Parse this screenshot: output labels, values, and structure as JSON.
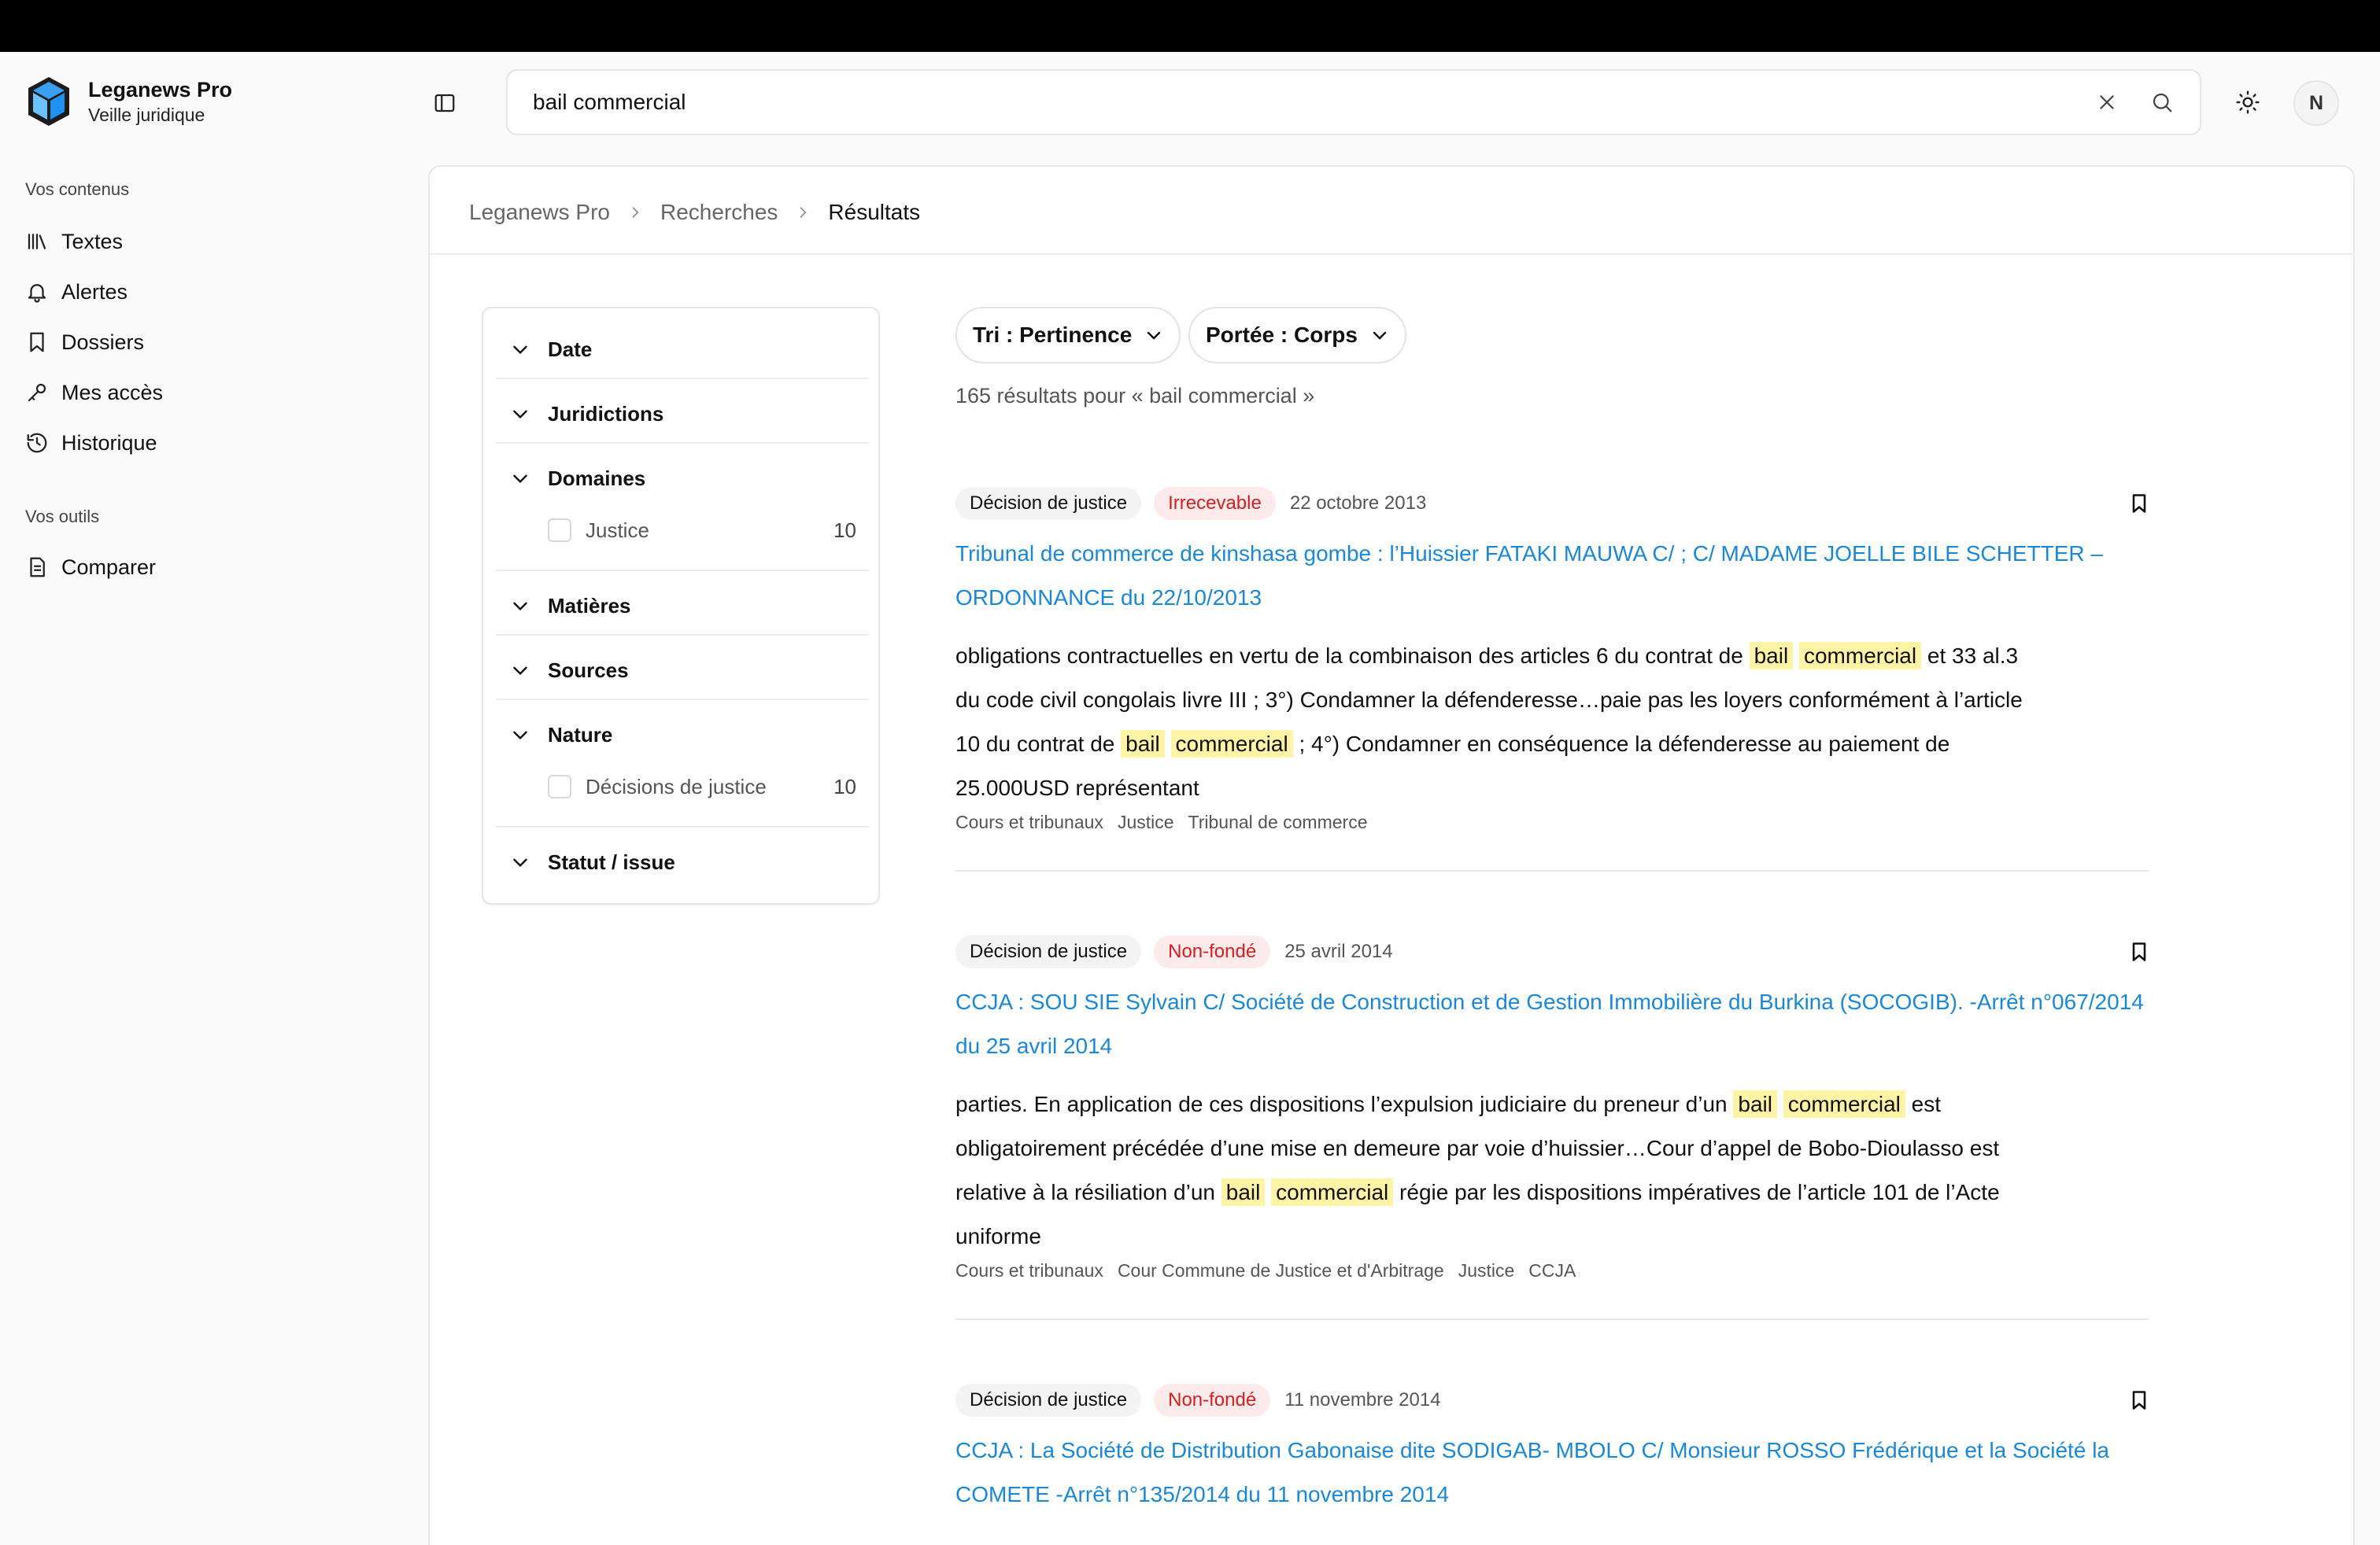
{
  "brand": {
    "name": "Leganews Pro",
    "subtitle": "Veille juridique"
  },
  "sidebar": {
    "section_contents": "Vos contenus",
    "items": [
      {
        "label": "Textes",
        "icon": "library-icon"
      },
      {
        "label": "Alertes",
        "icon": "bell-icon"
      },
      {
        "label": "Dossiers",
        "icon": "bookmark-icon"
      },
      {
        "label": "Mes accès",
        "icon": "key-icon"
      },
      {
        "label": "Historique",
        "icon": "history-icon"
      }
    ],
    "section_tools": "Vos outils",
    "tools": [
      {
        "label": "Comparer",
        "icon": "document-icon"
      }
    ]
  },
  "search": {
    "value": "bail commercial"
  },
  "user": {
    "initial": "N"
  },
  "breadcrumb": [
    "Leganews Pro",
    "Recherches",
    "Résultats"
  ],
  "filters": {
    "date": "Date",
    "juridictions": "Juridictions",
    "domaines": "Domaines",
    "domaines_options": [
      {
        "label": "Justice",
        "count": "10"
      }
    ],
    "matieres": "Matières",
    "sources": "Sources",
    "nature": "Nature",
    "nature_options": [
      {
        "label": "Décisions de justice",
        "count": "10"
      }
    ],
    "statut": "Statut / issue"
  },
  "sort": {
    "tri": "Tri : Pertinence",
    "portee": "Portée : Corps"
  },
  "results_count": "165 résultats pour « bail commercial »",
  "results": [
    {
      "type": "Décision de justice",
      "status": "Irrecevable",
      "date": "22 octobre 2013",
      "title": "Tribunal de commerce de kinshasa gombe : l’Huissier FATAKI MAUWA C/ ; C/ MADAME JOELLE BILE SCHETTER –ORDONNANCE du 22/10/2013",
      "snippet": [
        {
          "t": "obligations contractuelles en vertu de la combinaison des articles 6 du contrat de "
        },
        {
          "t": "bail",
          "h": true
        },
        {
          "t": " "
        },
        {
          "t": "commercial",
          "h": true
        },
        {
          "t": " et 33 al.3 du code civil congolais livre III ; 3°) Condamner la défenderesse…paie pas les loyers conformément à l’article 10 du contrat de "
        },
        {
          "t": "bail",
          "h": true
        },
        {
          "t": " "
        },
        {
          "t": "commercial",
          "h": true
        },
        {
          "t": " ; 4°) Condamner en conséquence la défenderesse au paiement de 25.000USD représentant"
        }
      ],
      "tags": [
        "Cours et tribunaux",
        "Justice",
        "Tribunal de commerce"
      ]
    },
    {
      "type": "Décision de justice",
      "status": "Non-fondé",
      "date": "25 avril 2014",
      "title": "CCJA : SOU SIE Sylvain C/ Société de Construction et de Gestion Immobilière du Burkina (SOCOGIB). -Arrêt n°067/2014 du 25 avril 2014",
      "snippet": [
        {
          "t": "parties. En application de ces dispositions l’expulsion judiciaire du preneur d’un "
        },
        {
          "t": "bail",
          "h": true
        },
        {
          "t": " "
        },
        {
          "t": "commercial",
          "h": true
        },
        {
          "t": " est obligatoirement précédée d’une mise en demeure par voie d’huissier…Cour d’appel de Bobo-Dioulasso est relative à la résiliation d’un "
        },
        {
          "t": "bail",
          "h": true
        },
        {
          "t": " "
        },
        {
          "t": "commercial",
          "h": true
        },
        {
          "t": " régie par les dispositions impératives de l’article 101 de l’Acte uniforme"
        }
      ],
      "tags": [
        "Cours et tribunaux",
        "Cour Commune de Justice et d'Arbitrage",
        "Justice",
        "CCJA"
      ]
    },
    {
      "type": "Décision de justice",
      "status": "Non-fondé",
      "date": "11 novembre 2014",
      "title": "CCJA : La Société de Distribution Gabonaise dite SODIGAB- MBOLO C/ Monsieur ROSSO Frédérique et la Société la COMETE -Arrêt n°135/2014 du 11 novembre 2014",
      "snippet": [],
      "tags": []
    }
  ],
  "colors": {
    "link": "#1a88d6",
    "status_text": "#d32020",
    "status_bg": "#fdeaea",
    "highlight": "#fff3a6",
    "logo_blue": "#1f8ff0"
  }
}
